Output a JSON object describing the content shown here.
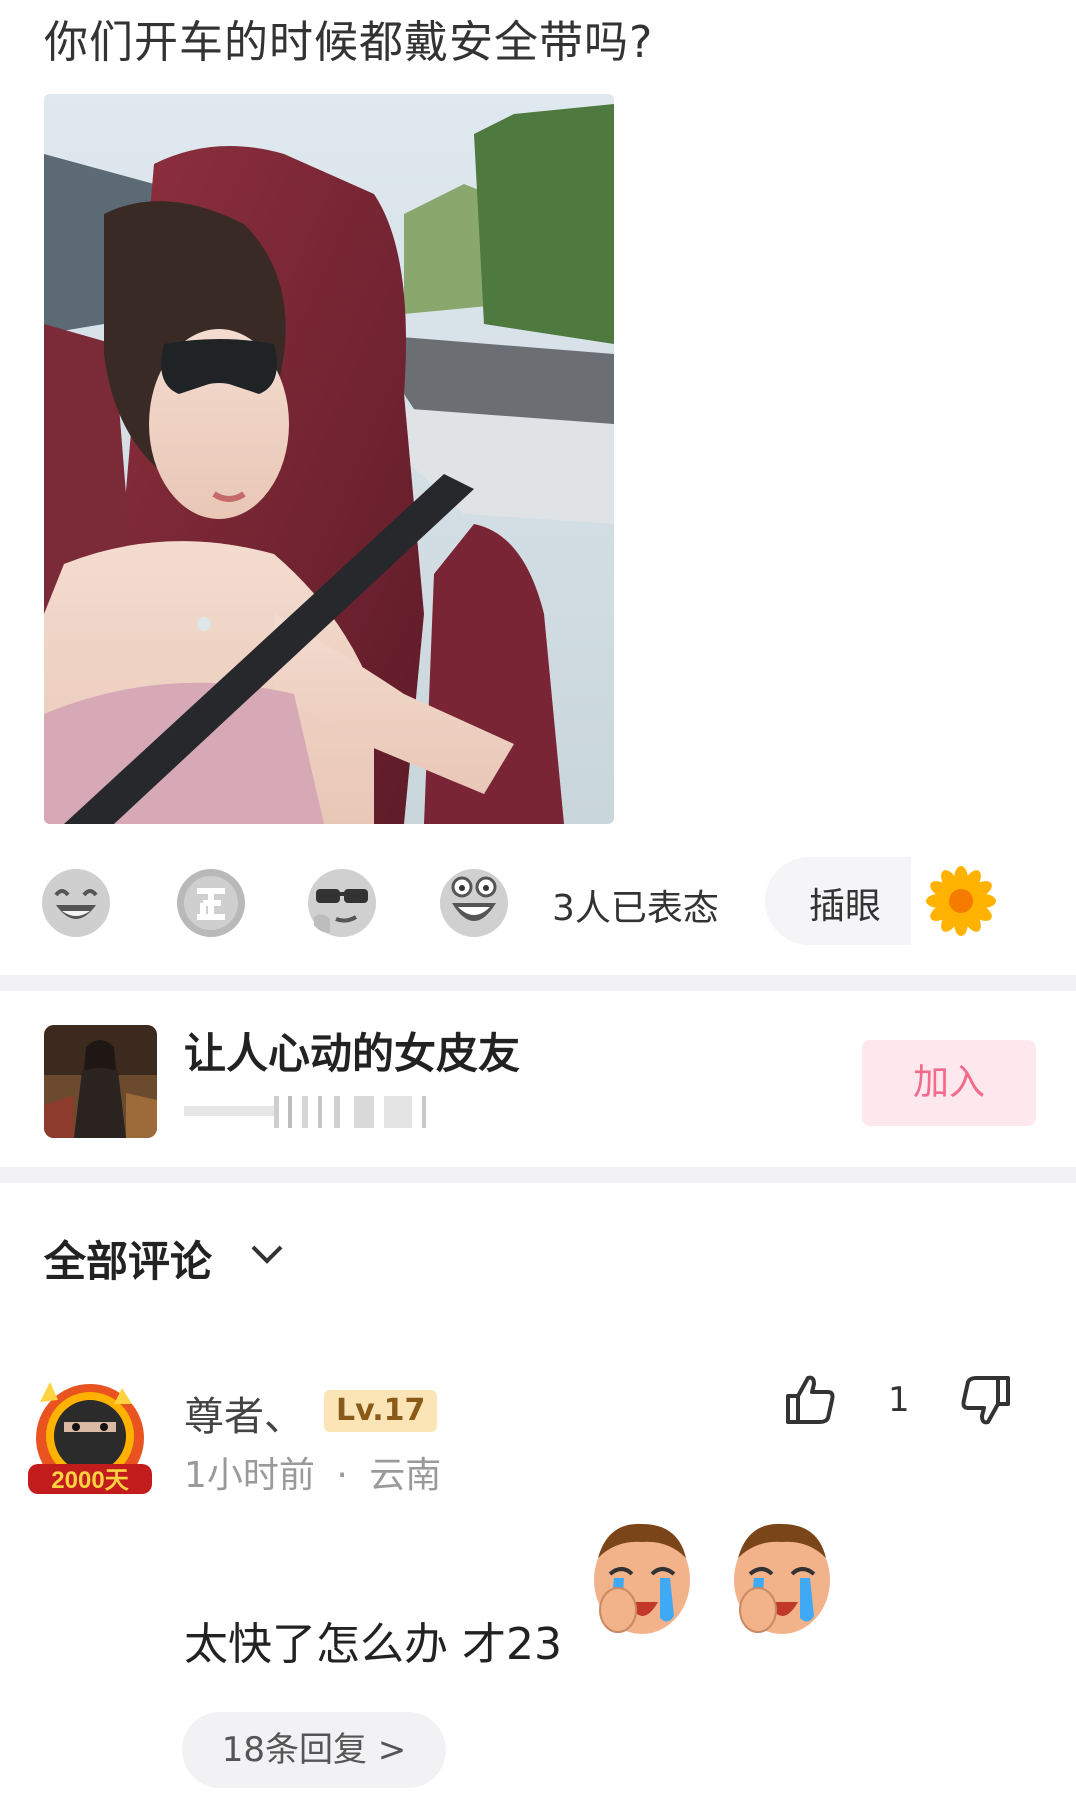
{
  "post": {
    "title": "你们开车的时候都戴安全带吗?"
  },
  "reactions": {
    "count_text": "3人已表态",
    "emoji_icons": [
      "laughing-face-icon",
      "zheng-badge-icon",
      "cool-sunglasses-face-icon",
      "grinning-face-icon"
    ],
    "poke_label": "插眼",
    "poke_icon": "sunflower-icon"
  },
  "group": {
    "name": "让人心动的女皮友",
    "join_label": "加入"
  },
  "comments": {
    "header": "全部评论",
    "items": [
      {
        "username": "尊者、",
        "level": "Lv.17",
        "time": "1小时前",
        "separator": "·",
        "location": "云南",
        "likes": "1",
        "text": "太快了怎么办 才23",
        "emojis": [
          "crying-face-icon",
          "crying-face-icon"
        ],
        "replies_label": "18条回复 >",
        "avatar_badge": "2000天"
      }
    ]
  },
  "colors": {
    "accent_pink": "#f26b8c",
    "join_bg": "#fde8ee",
    "level_bg": "#fbe5b6",
    "divider": "#f2f2f4"
  }
}
